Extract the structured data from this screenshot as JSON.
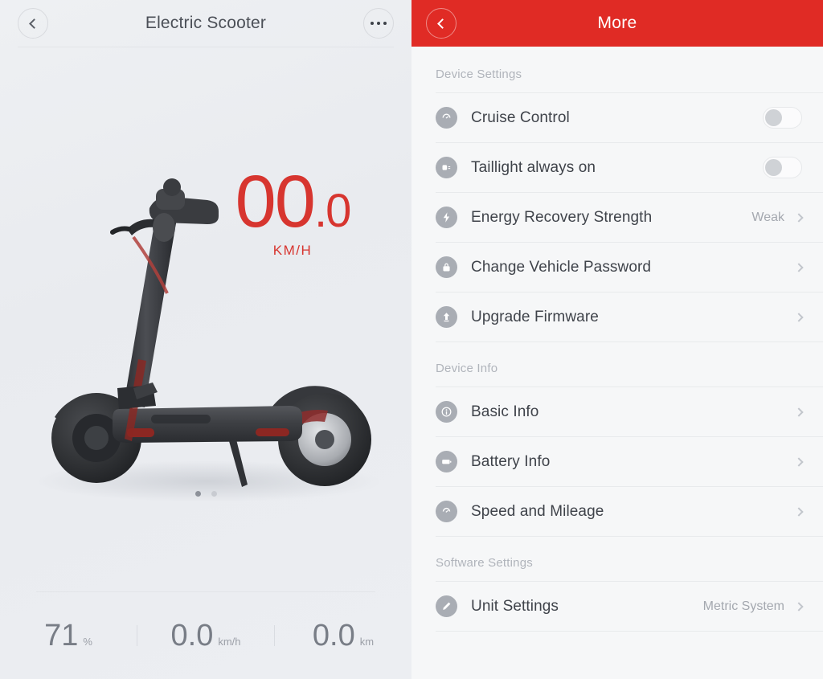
{
  "left": {
    "header": {
      "back_icon": "chevron-left-icon",
      "title": "Electric Scooter",
      "more_icon": "ellipsis-icon"
    },
    "speed": {
      "whole": "00",
      "decimal": ".0",
      "unit": "KM/H"
    },
    "pager": {
      "count": 2,
      "active": 0
    },
    "stats": [
      {
        "name": "battery",
        "value": "71",
        "unit": "%"
      },
      {
        "name": "speed",
        "value": "0.0",
        "unit": "km/h"
      },
      {
        "name": "mileage",
        "value": "0.0",
        "unit": "km"
      }
    ]
  },
  "right": {
    "header": {
      "back_icon": "chevron-left-icon",
      "title": "More",
      "bg_color": "#e02b25"
    },
    "sections": [
      {
        "title": "Device Settings",
        "rows": [
          {
            "icon": "speedometer-icon",
            "label": "Cruise Control",
            "control": "toggle",
            "value": "",
            "on": false
          },
          {
            "icon": "taillight-icon",
            "label": "Taillight always on",
            "control": "toggle",
            "value": "",
            "on": false
          },
          {
            "icon": "bolt-icon",
            "label": "Energy Recovery Strength",
            "control": "chevron",
            "value": "Weak"
          },
          {
            "icon": "lock-icon",
            "label": "Change Vehicle Password",
            "control": "chevron",
            "value": ""
          },
          {
            "icon": "upload-arrow-icon",
            "label": "Upgrade Firmware",
            "control": "chevron",
            "value": ""
          }
        ]
      },
      {
        "title": "Device Info",
        "rows": [
          {
            "icon": "info-icon",
            "label": "Basic Info",
            "control": "chevron",
            "value": ""
          },
          {
            "icon": "battery-icon",
            "label": "Battery Info",
            "control": "chevron",
            "value": ""
          },
          {
            "icon": "gauge-icon",
            "label": "Speed and Mileage",
            "control": "chevron",
            "value": ""
          }
        ]
      },
      {
        "title": "Software Settings",
        "rows": [
          {
            "icon": "pencil-icon",
            "label": "Unit Settings",
            "control": "chevron",
            "value": "Metric System"
          }
        ]
      }
    ]
  },
  "colors": {
    "accent_red": "#d7352f",
    "header_red": "#e02b25",
    "icon_gray": "#a9adb4",
    "text_dark": "#3f434a",
    "text_muted": "#a4a8af"
  }
}
